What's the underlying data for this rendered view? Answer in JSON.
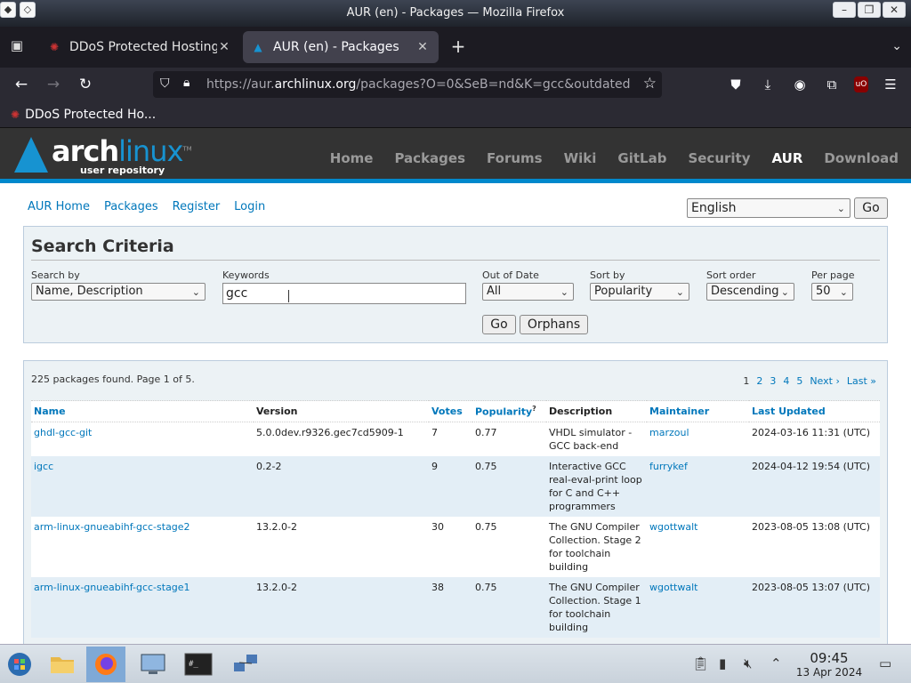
{
  "window": {
    "title": "AUR (en) - Packages — Mozilla Firefox"
  },
  "tabs": [
    {
      "label": "DDoS Protected Hosting",
      "icon": "ddos-favicon",
      "active": false
    },
    {
      "label": "AUR (en) - Packages",
      "icon": "arch-favicon",
      "active": true
    }
  ],
  "nav": {
    "url_prefix": "https://aur.",
    "url_domain": "archlinux.org",
    "url_suffix": "/packages?O=0&SeB=nd&K=gcc&outdated"
  },
  "bookmarks": [
    {
      "label": "DDoS Protected Ho..."
    }
  ],
  "site": {
    "logo_arch": "arch",
    "logo_linux": "linux",
    "logo_sub": "user repository",
    "logo_tm": "TM",
    "nav": [
      "Home",
      "Packages",
      "Forums",
      "Wiki",
      "GitLab",
      "Security",
      "AUR",
      "Download"
    ],
    "active_nav": "AUR"
  },
  "aur_nav": [
    "AUR Home",
    "Packages",
    "Register",
    "Login"
  ],
  "language": {
    "selected": "English",
    "go": "Go"
  },
  "search": {
    "heading": "Search Criteria",
    "search_by_label": "Search by",
    "search_by_value": "Name, Description",
    "keywords_label": "Keywords",
    "keywords_value": "gcc",
    "out_of_date_label": "Out of Date",
    "out_of_date_value": "All",
    "sort_by_label": "Sort by",
    "sort_by_value": "Popularity",
    "sort_order_label": "Sort order",
    "sort_order_value": "Descending",
    "per_page_label": "Per page",
    "per_page_value": "50",
    "go_button": "Go",
    "orphans_button": "Orphans"
  },
  "results": {
    "summary": "225 packages found. Page 1 of 5.",
    "pager": {
      "current": "1",
      "pages": [
        "2",
        "3",
        "4",
        "5"
      ],
      "next": "Next ›",
      "last": "Last »"
    },
    "columns": {
      "name": "Name",
      "version": "Version",
      "votes": "Votes",
      "popularity": "Popularity",
      "popularity_sup": "?",
      "description": "Description",
      "maintainer": "Maintainer",
      "last_updated": "Last Updated"
    },
    "rows": [
      {
        "name": "ghdl-gcc-git",
        "version": "5.0.0dev.r9326.gec7cd5909-1",
        "votes": "7",
        "popularity": "0.77",
        "description": "VHDL simulator - GCC back-end",
        "maintainer": "marzoul",
        "updated": "2024-03-16 11:31 (UTC)"
      },
      {
        "name": "igcc",
        "version": "0.2-2",
        "votes": "9",
        "popularity": "0.75",
        "description": "Interactive GCC real-eval-print loop for C and C++ programmers",
        "maintainer": "furrykef",
        "updated": "2024-04-12 19:54 (UTC)"
      },
      {
        "name": "arm-linux-gnueabihf-gcc-stage2",
        "version": "13.2.0-2",
        "votes": "30",
        "popularity": "0.75",
        "description": "The GNU Compiler Collection. Stage 2 for toolchain building",
        "maintainer": "wgottwalt",
        "updated": "2023-08-05 13:08 (UTC)"
      },
      {
        "name": "arm-linux-gnueabihf-gcc-stage1",
        "version": "13.2.0-2",
        "votes": "38",
        "popularity": "0.75",
        "description": "The GNU Compiler Collection. Stage 1 for toolchain building",
        "maintainer": "wgottwalt",
        "updated": "2023-08-05 13:07 (UTC)"
      }
    ]
  },
  "taskbar": {
    "time": "09:45",
    "date": "13 Apr 2024"
  },
  "colors": {
    "arch_blue": "#1793d1",
    "link": "#0077bb",
    "header_bg": "#333333",
    "box_bg": "#ecf2f5"
  }
}
